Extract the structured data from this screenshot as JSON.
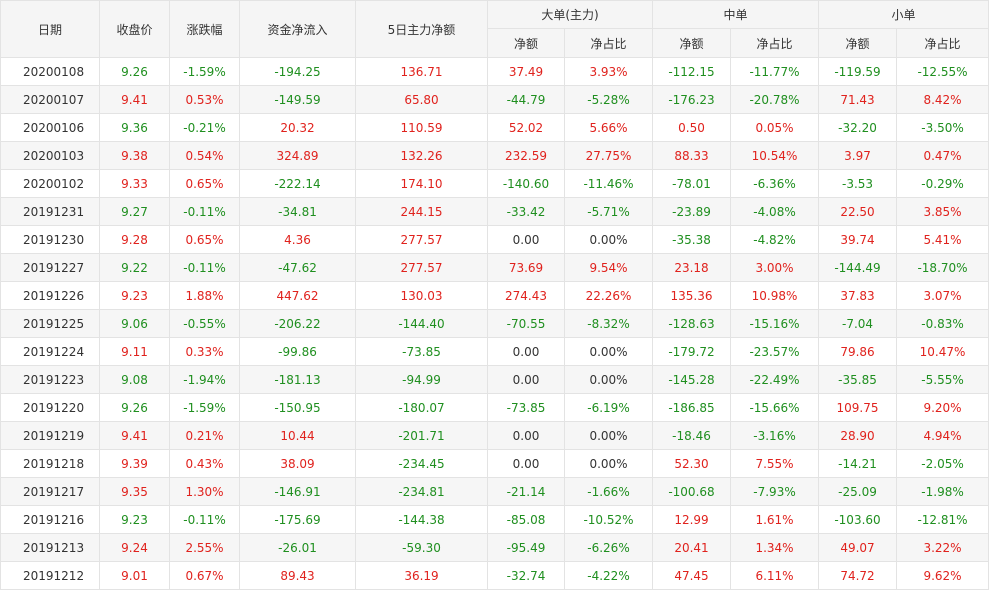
{
  "colors": {
    "up": "#e0221d",
    "down": "#1f8f1f",
    "header_bg": "#f5f5f5",
    "border": "#e3e3e3",
    "alt_row_bg": "#f6f6f6"
  },
  "header": {
    "date": "日期",
    "close": "收盘价",
    "change": "涨跌幅",
    "net_inflow": "资金净流入",
    "main_5d": "5日主力净额",
    "large": "大单(主力)",
    "medium": "中单",
    "small": "小单",
    "net_amount": "净额",
    "net_ratio": "净占比"
  },
  "rows": [
    {
      "date": "20200108",
      "close": "9.26",
      "change": "-1.59%",
      "net_inflow": "-194.25",
      "main_5d": "136.71",
      "large_amt": "37.49",
      "large_pct": "3.93%",
      "mid_amt": "-112.15",
      "mid_pct": "-11.77%",
      "small_amt": "-119.59",
      "small_pct": "-12.55%"
    },
    {
      "date": "20200107",
      "close": "9.41",
      "change": "0.53%",
      "net_inflow": "-149.59",
      "main_5d": "65.80",
      "large_amt": "-44.79",
      "large_pct": "-5.28%",
      "mid_amt": "-176.23",
      "mid_pct": "-20.78%",
      "small_amt": "71.43",
      "small_pct": "8.42%"
    },
    {
      "date": "20200106",
      "close": "9.36",
      "change": "-0.21%",
      "net_inflow": "20.32",
      "main_5d": "110.59",
      "large_amt": "52.02",
      "large_pct": "5.66%",
      "mid_amt": "0.50",
      "mid_pct": "0.05%",
      "small_amt": "-32.20",
      "small_pct": "-3.50%"
    },
    {
      "date": "20200103",
      "close": "9.38",
      "change": "0.54%",
      "net_inflow": "324.89",
      "main_5d": "132.26",
      "large_amt": "232.59",
      "large_pct": "27.75%",
      "mid_amt": "88.33",
      "mid_pct": "10.54%",
      "small_amt": "3.97",
      "small_pct": "0.47%"
    },
    {
      "date": "20200102",
      "close": "9.33",
      "change": "0.65%",
      "net_inflow": "-222.14",
      "main_5d": "174.10",
      "large_amt": "-140.60",
      "large_pct": "-11.46%",
      "mid_amt": "-78.01",
      "mid_pct": "-6.36%",
      "small_amt": "-3.53",
      "small_pct": "-0.29%"
    },
    {
      "date": "20191231",
      "close": "9.27",
      "change": "-0.11%",
      "net_inflow": "-34.81",
      "main_5d": "244.15",
      "large_amt": "-33.42",
      "large_pct": "-5.71%",
      "mid_amt": "-23.89",
      "mid_pct": "-4.08%",
      "small_amt": "22.50",
      "small_pct": "3.85%"
    },
    {
      "date": "20191230",
      "close": "9.28",
      "change": "0.65%",
      "net_inflow": "4.36",
      "main_5d": "277.57",
      "large_amt": "0.00",
      "large_pct": "0.00%",
      "mid_amt": "-35.38",
      "mid_pct": "-4.82%",
      "small_amt": "39.74",
      "small_pct": "5.41%"
    },
    {
      "date": "20191227",
      "close": "9.22",
      "change": "-0.11%",
      "net_inflow": "-47.62",
      "main_5d": "277.57",
      "large_amt": "73.69",
      "large_pct": "9.54%",
      "mid_amt": "23.18",
      "mid_pct": "3.00%",
      "small_amt": "-144.49",
      "small_pct": "-18.70%"
    },
    {
      "date": "20191226",
      "close": "9.23",
      "change": "1.88%",
      "net_inflow": "447.62",
      "main_5d": "130.03",
      "large_amt": "274.43",
      "large_pct": "22.26%",
      "mid_amt": "135.36",
      "mid_pct": "10.98%",
      "small_amt": "37.83",
      "small_pct": "3.07%"
    },
    {
      "date": "20191225",
      "close": "9.06",
      "change": "-0.55%",
      "net_inflow": "-206.22",
      "main_5d": "-144.40",
      "large_amt": "-70.55",
      "large_pct": "-8.32%",
      "mid_amt": "-128.63",
      "mid_pct": "-15.16%",
      "small_amt": "-7.04",
      "small_pct": "-0.83%"
    },
    {
      "date": "20191224",
      "close": "9.11",
      "change": "0.33%",
      "net_inflow": "-99.86",
      "main_5d": "-73.85",
      "large_amt": "0.00",
      "large_pct": "0.00%",
      "mid_amt": "-179.72",
      "mid_pct": "-23.57%",
      "small_amt": "79.86",
      "small_pct": "10.47%"
    },
    {
      "date": "20191223",
      "close": "9.08",
      "change": "-1.94%",
      "net_inflow": "-181.13",
      "main_5d": "-94.99",
      "large_amt": "0.00",
      "large_pct": "0.00%",
      "mid_amt": "-145.28",
      "mid_pct": "-22.49%",
      "small_amt": "-35.85",
      "small_pct": "-5.55%"
    },
    {
      "date": "20191220",
      "close": "9.26",
      "change": "-1.59%",
      "net_inflow": "-150.95",
      "main_5d": "-180.07",
      "large_amt": "-73.85",
      "large_pct": "-6.19%",
      "mid_amt": "-186.85",
      "mid_pct": "-15.66%",
      "small_amt": "109.75",
      "small_pct": "9.20%"
    },
    {
      "date": "20191219",
      "close": "9.41",
      "change": "0.21%",
      "net_inflow": "10.44",
      "main_5d": "-201.71",
      "large_amt": "0.00",
      "large_pct": "0.00%",
      "mid_amt": "-18.46",
      "mid_pct": "-3.16%",
      "small_amt": "28.90",
      "small_pct": "4.94%"
    },
    {
      "date": "20191218",
      "close": "9.39",
      "change": "0.43%",
      "net_inflow": "38.09",
      "main_5d": "-234.45",
      "large_amt": "0.00",
      "large_pct": "0.00%",
      "mid_amt": "52.30",
      "mid_pct": "7.55%",
      "small_amt": "-14.21",
      "small_pct": "-2.05%"
    },
    {
      "date": "20191217",
      "close": "9.35",
      "change": "1.30%",
      "net_inflow": "-146.91",
      "main_5d": "-234.81",
      "large_amt": "-21.14",
      "large_pct": "-1.66%",
      "mid_amt": "-100.68",
      "mid_pct": "-7.93%",
      "small_amt": "-25.09",
      "small_pct": "-1.98%"
    },
    {
      "date": "20191216",
      "close": "9.23",
      "change": "-0.11%",
      "net_inflow": "-175.69",
      "main_5d": "-144.38",
      "large_amt": "-85.08",
      "large_pct": "-10.52%",
      "mid_amt": "12.99",
      "mid_pct": "1.61%",
      "small_amt": "-103.60",
      "small_pct": "-12.81%"
    },
    {
      "date": "20191213",
      "close": "9.24",
      "change": "2.55%",
      "net_inflow": "-26.01",
      "main_5d": "-59.30",
      "large_amt": "-95.49",
      "large_pct": "-6.26%",
      "mid_amt": "20.41",
      "mid_pct": "1.34%",
      "small_amt": "49.07",
      "small_pct": "3.22%"
    },
    {
      "date": "20191212",
      "close": "9.01",
      "change": "0.67%",
      "net_inflow": "89.43",
      "main_5d": "36.19",
      "large_amt": "-32.74",
      "large_pct": "-4.22%",
      "mid_amt": "47.45",
      "mid_pct": "6.11%",
      "small_amt": "74.72",
      "small_pct": "9.62%"
    }
  ]
}
